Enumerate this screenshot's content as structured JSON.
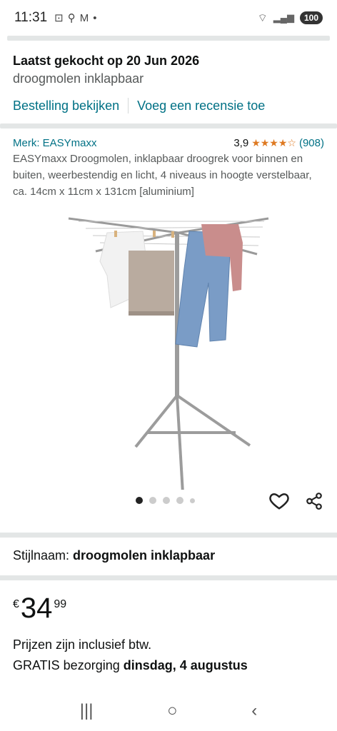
{
  "status": {
    "time": "11:31",
    "battery": "100",
    "left_icons": [
      "screenshot-icon",
      "walk-icon",
      "gmail-icon",
      "dot-icon"
    ]
  },
  "order": {
    "title": "Laatst gekocht op 20 Jun 2026",
    "subtitle": "droogmolen inklapbaar",
    "view_order": "Bestelling bekijken",
    "add_review": "Voeg een recensie toe"
  },
  "product": {
    "brand": "Merk: EASYmaxx",
    "rating": "3,9",
    "stars": "★★★★☆",
    "rating_value": 3.9,
    "review_count": "(908)",
    "title": "EASYmaxx Droogmolen, inklapbaar droogrek voor binnen en buiten, weerbestendig en licht, 4 niveaus in hoogte verstelbaar, ca. 14cm x 11cm x 131cm [aluminium]",
    "image_index": 1,
    "image_count": 5
  },
  "style": {
    "label": "Stijlnaam:",
    "value": "droogmolen inklapbaar"
  },
  "price": {
    "currency": "€",
    "whole": "34",
    "fraction": "99",
    "vat_note": "Prijzen zijn inclusief btw.",
    "delivery_prefix": "GRATIS bezorging",
    "delivery_date": "dinsdag, 4 augustus"
  },
  "colors": {
    "link": "#007185",
    "star": "#de7921",
    "separator": "#e3e6e6"
  }
}
